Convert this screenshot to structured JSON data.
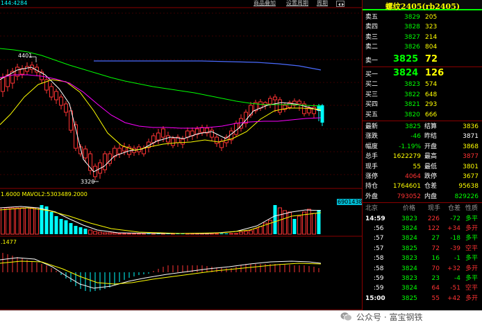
{
  "toolbar": {
    "left_label": "144:4284",
    "links": [
      "商品叠加",
      "设置周期",
      "周期"
    ],
    "icons": [
      "arrows-icon"
    ]
  },
  "main_chart": {
    "high_label": "4401",
    "low_label": "3320"
  },
  "volume_panel": {
    "label": "1.6000  MAVOL2:5303489.2000",
    "current_value": "6901438"
  },
  "macd_panel": {
    "label": ".1477"
  },
  "quote": {
    "title": "螺纹2405(rb2405)",
    "asks": [
      {
        "label": "卖五",
        "price": "3829",
        "vol": "205"
      },
      {
        "label": "卖四",
        "price": "3828",
        "vol": "323"
      },
      {
        "label": "卖三",
        "price": "3827",
        "vol": "214"
      },
      {
        "label": "卖二",
        "price": "3826",
        "vol": "804"
      }
    ],
    "ask1": {
      "label": "卖一",
      "price": "3825",
      "vol": "72"
    },
    "bid1": {
      "label": "买一",
      "price": "3824",
      "vol": "126"
    },
    "bids": [
      {
        "label": "买二",
        "price": "3823",
        "vol": "574"
      },
      {
        "label": "买三",
        "price": "3822",
        "vol": "648"
      },
      {
        "label": "买四",
        "price": "3821",
        "vol": "293"
      },
      {
        "label": "买五",
        "price": "3820",
        "vol": "666"
      }
    ],
    "stats": [
      {
        "l1": "最新",
        "v1": "3825",
        "c1": "#00ff00",
        "l2": "结算",
        "v2": "3836",
        "c2": "#ffff00"
      },
      {
        "l1": "涨跌",
        "v1": "-46",
        "c1": "#00ff00",
        "l2": "昨结",
        "v2": "3871",
        "c2": "#ffffff"
      },
      {
        "l1": "幅度",
        "v1": "-1.19%",
        "c1": "#00ff00",
        "l2": "开盘",
        "v2": "3868",
        "c2": "#ffff00"
      },
      {
        "l1": "总手",
        "v1": "1622279",
        "c1": "#ffff00",
        "l2": "最高",
        "v2": "3877",
        "c2": "#ff3333"
      },
      {
        "l1": "现手",
        "v1": "55",
        "c1": "#ffff00",
        "l2": "最低",
        "v2": "3801",
        "c2": "#ffff00"
      },
      {
        "l1": "涨停",
        "v1": "4064",
        "c1": "#ff3333",
        "l2": "跌停",
        "v2": "3677",
        "c2": "#ffff00"
      },
      {
        "l1": "持仓",
        "v1": "1764601",
        "c1": "#ffff00",
        "l2": "仓差",
        "v2": "95638",
        "c2": "#ffff00"
      },
      {
        "l1": "外盘",
        "v1": "793052",
        "c1": "#ff3333",
        "l2": "内盘",
        "v2": "829226",
        "c2": "#00ff00"
      }
    ],
    "ticks_header": [
      "北京",
      "价格",
      "现手",
      "仓差",
      "性质"
    ],
    "ticks": [
      {
        "time": "14:59",
        "price": "3823",
        "vol": "226",
        "diff": "-72",
        "nature": "多平",
        "cv": "#ff3333",
        "cd": "#00ff00",
        "cn": "#00ff00"
      },
      {
        "time": ":56",
        "price": "3824",
        "vol": "122",
        "diff": "+34",
        "nature": "多开",
        "cv": "#ff3333",
        "cd": "#ff3333",
        "cn": "#ff3333"
      },
      {
        "time": ":57",
        "price": "3824",
        "vol": "27",
        "diff": "-18",
        "nature": "多平",
        "cv": "#00ff00",
        "cd": "#00ff00",
        "cn": "#00ff00"
      },
      {
        "time": ":57",
        "price": "3825",
        "vol": "72",
        "diff": "-39",
        "nature": "空平",
        "cv": "#ff3333",
        "cd": "#ff3333",
        "cn": "#ff3333"
      },
      {
        "time": ":58",
        "price": "3823",
        "vol": "16",
        "diff": "-1",
        "nature": "多平",
        "cv": "#00ff00",
        "cd": "#00ff00",
        "cn": "#00ff00"
      },
      {
        "time": ":58",
        "price": "3824",
        "vol": "70",
        "diff": "+32",
        "nature": "多开",
        "cv": "#ff3333",
        "cd": "#ff3333",
        "cn": "#ff3333"
      },
      {
        "time": ":59",
        "price": "3823",
        "vol": "23",
        "diff": "-4",
        "nature": "多平",
        "cv": "#00ff00",
        "cd": "#00ff00",
        "cn": "#00ff00"
      },
      {
        "time": ":59",
        "price": "3824",
        "vol": "64",
        "diff": "-51",
        "nature": "空平",
        "cv": "#ff3333",
        "cd": "#ff3333",
        "cn": "#ff3333"
      },
      {
        "time": "15:00",
        "price": "3825",
        "vol": "55",
        "diff": "+42",
        "nature": "多开",
        "cv": "#ff3333",
        "cd": "#ff3333",
        "cn": "#ff3333"
      }
    ]
  },
  "watermark": {
    "text": "公众号 · 富宝钢铁",
    "icon": "wechat-icon"
  },
  "colors": {
    "up": "#ff3333",
    "down": "#00ffff",
    "ma5": "#ffffff",
    "ma10": "#ffff00",
    "ma20": "#ff00ff",
    "ma40": "#00ff00",
    "ma60": "#4a6bff",
    "price_green": "#00ff00",
    "label_yellow": "#ffff00"
  }
}
